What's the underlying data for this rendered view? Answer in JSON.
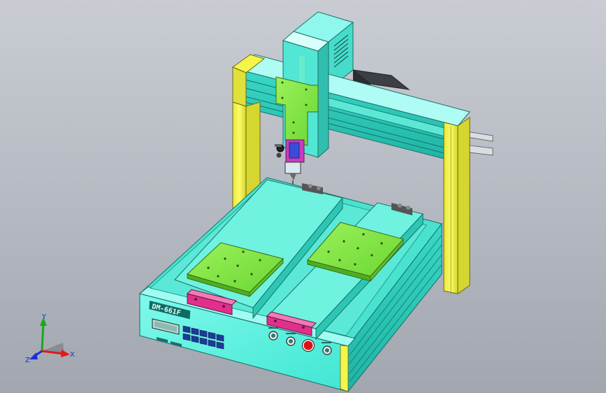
{
  "machine": {
    "model_plate": "DM-661F"
  },
  "triad": {
    "x_label": "X",
    "y_label": "Y",
    "z_label": "Z",
    "x_color": "#e01818",
    "y_color": "#1aa81a",
    "z_color": "#1a2fd8"
  },
  "palette": {
    "body_cyan": "#48f0dc",
    "frame_yellow": "#f4f44a",
    "fixture_green": "#7ee840",
    "clamp_magenta": "#e0308c",
    "estop_red": "#e01010",
    "background": "#c0c3ca"
  },
  "icons": [
    "xyz-triad-icon",
    "emergency-stop-icon",
    "control-knob-icon"
  ]
}
